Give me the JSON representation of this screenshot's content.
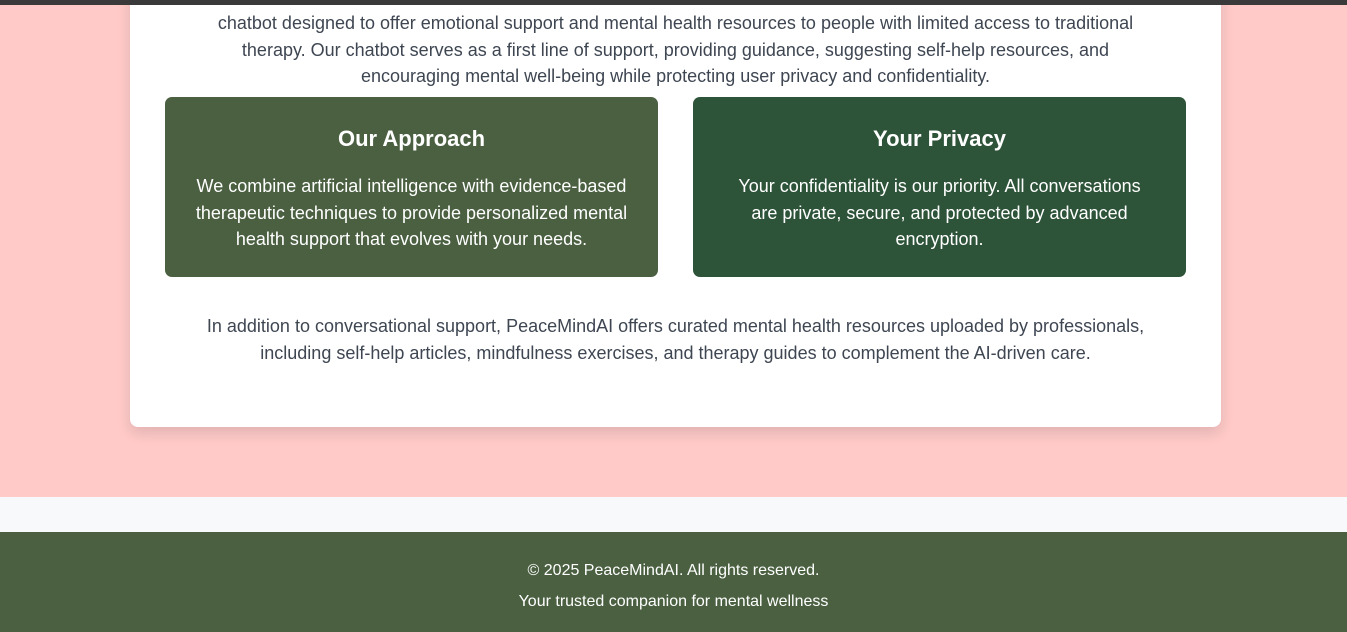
{
  "about": {
    "intro_text": "chatbot designed to offer emotional support and mental health resources to people with limited access to traditional therapy. Our chatbot serves as a first line of support, providing guidance, suggesting self-help resources, and encouraging mental well-being while protecting user privacy and confidentiality.",
    "approach": {
      "title": "Our Approach",
      "text": "We combine artificial intelligence with evidence-based therapeutic techniques to provide personalized mental health support that evolves with your needs."
    },
    "privacy": {
      "title": "Your Privacy",
      "text": "Your confidentiality is our priority. All conversations are private, secure, and protected by advanced encryption."
    },
    "closing_text": "In addition to conversational support, PeaceMindAI offers curated mental health resources uploaded by professionals, including self-help articles, mindfulness exercises, and therapy guides to complement the AI-driven care."
  },
  "footer": {
    "copyright": "© 2025 PeaceMindAI. All rights reserved.",
    "tagline": "Your trusted companion for mental wellness"
  },
  "colors": {
    "section_background": "#ffcac8",
    "approach_box": "#4a6041",
    "privacy_box": "#2d5339",
    "footer_background": "#4a6041",
    "body_text": "#3e4652"
  }
}
